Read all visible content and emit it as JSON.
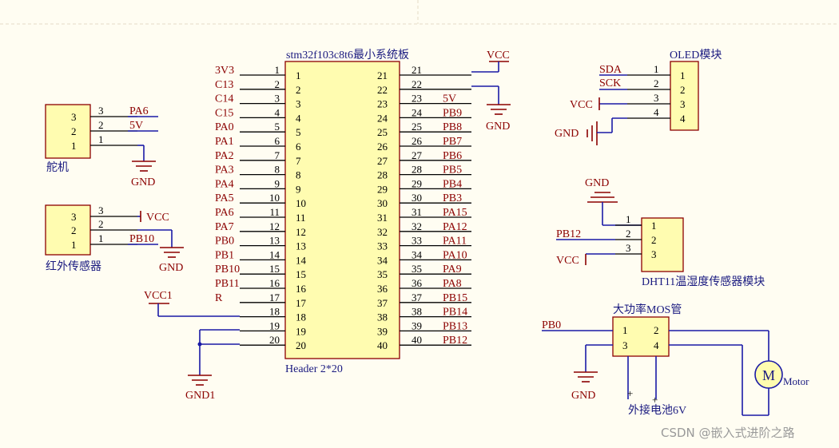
{
  "mcu": {
    "title": "stm32f103c8t6最小系统板",
    "footer": "Header 2*20",
    "left_nets": [
      "3V3",
      "C13",
      "C14",
      "C15",
      "PA0",
      "PA1",
      "PA2",
      "PA3",
      "PA4",
      "PA5",
      "PA6",
      "PA7",
      "PB0",
      "PB1",
      "PB10",
      "PB11",
      "R",
      "",
      "",
      ""
    ],
    "right_nets": [
      "",
      "",
      "5V",
      "PB9",
      "PB8",
      "PB7",
      "PB6",
      "PB5",
      "PB4",
      "PB3",
      "PA15",
      "PA12",
      "PA11",
      "PA10",
      "PA9",
      "PA8",
      "PB15",
      "PB14",
      "PB13",
      "PB12"
    ],
    "vcc_label": "VCC",
    "gnd_label": "GND",
    "vcc1_label": "VCC1",
    "gnd1_label": "GND1"
  },
  "servo": {
    "title": "舵机",
    "pins": [
      "3",
      "2",
      "1"
    ],
    "nets": [
      "PA6",
      "5V",
      ""
    ],
    "gnd_label": "GND"
  },
  "ir": {
    "title": "红外传感器",
    "pins": [
      "3",
      "2",
      "1"
    ],
    "nets": [
      "VCC",
      "",
      "PB10"
    ],
    "gnd_label": "GND"
  },
  "oled": {
    "title": "OLED模块",
    "pins": [
      "1",
      "2",
      "3",
      "4"
    ],
    "nets": [
      "SDA",
      "SCK",
      "VCC",
      "GND"
    ]
  },
  "dht11": {
    "title": "DHT11温湿度传感器模块",
    "pins": [
      "1",
      "2",
      "3"
    ],
    "nets": [
      "GND",
      "PB12",
      "VCC"
    ],
    "gnd_label": "GND"
  },
  "mos": {
    "title": "大功率MOS管",
    "pins": [
      "1",
      "2",
      "3",
      "4"
    ],
    "input_net": "PB0",
    "gnd_label": "GND",
    "battery_label": "外接电池6V",
    "plus_a": "+",
    "plus_b": "+",
    "motor_letter": "M",
    "motor_label": "Motor"
  },
  "watermark": "CSDN @嵌入式进阶之路"
}
